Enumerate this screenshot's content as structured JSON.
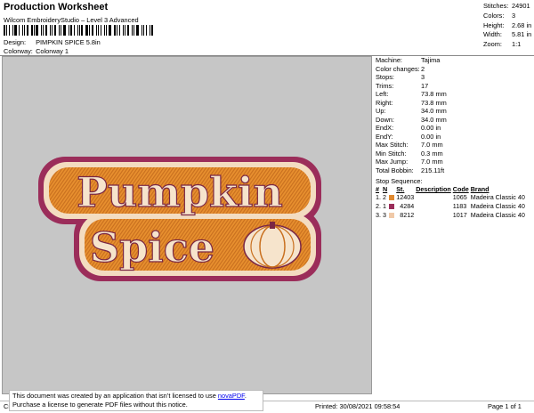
{
  "header": {
    "title": "Production Worksheet",
    "subtitle": "Wilcom EmbroideryStudio – Level 3 Advanced",
    "design_label": "Design:",
    "design_value": "PIMPKIN SPICE 5.8in",
    "colorway_label": "Colorway:",
    "colorway_value": "Colorway 1"
  },
  "stats": [
    {
      "label": "Stitches:",
      "value": "24901"
    },
    {
      "label": "Colors:",
      "value": "3"
    },
    {
      "label": "Height:",
      "value": "2.68 in"
    },
    {
      "label": "Width:",
      "value": "5.81 in"
    },
    {
      "label": "Zoom:",
      "value": "1:1"
    }
  ],
  "design_text": {
    "line1": "Pumpkin",
    "line2": "Spice"
  },
  "info": [
    {
      "label": "Machine:",
      "value": "Tajima"
    },
    {
      "label": "Color changes:",
      "value": "2"
    },
    {
      "label": "Stops:",
      "value": "3"
    },
    {
      "label": "Trims:",
      "value": "17"
    },
    {
      "label": "Left:",
      "value": "73.8 mm"
    },
    {
      "label": "Right:",
      "value": "73.8 mm"
    },
    {
      "label": "Up:",
      "value": "34.0 mm"
    },
    {
      "label": "Down:",
      "value": "34.0 mm"
    },
    {
      "label": "EndX:",
      "value": "0.00 in"
    },
    {
      "label": "EndY:",
      "value": "0.00 in"
    },
    {
      "label": "Max Stitch:",
      "value": "7.0 mm"
    },
    {
      "label": "Min Stitch:",
      "value": "0.3 mm"
    },
    {
      "label": "Max Jump:",
      "value": "7.0 mm"
    },
    {
      "label": "Total Bobbin:",
      "value": "215.11ft"
    }
  ],
  "stop_sequence": {
    "title": "Stop Sequence:",
    "headers": {
      "num": "#",
      "n": "N",
      "st": "St.",
      "description": "Description",
      "code": "Code",
      "brand": "Brand"
    },
    "rows": [
      {
        "num": "1.",
        "n": "2",
        "color": "#e0892f",
        "st": "12403",
        "description": "",
        "code": "1065",
        "brand": "Madeira Classic 40"
      },
      {
        "num": "2.",
        "n": "1",
        "color": "#9b2d5a",
        "st": "4284",
        "description": "",
        "code": "1183",
        "brand": "Madeira Classic 40"
      },
      {
        "num": "3.",
        "n": "3",
        "color": "#f0c9a8",
        "st": "8212",
        "description": "",
        "code": "1017",
        "brand": "Madeira Classic 40"
      }
    ]
  },
  "notice": {
    "line1_prefix": "This document was created by an application that isn’t licensed to use ",
    "link": "novaPDF",
    "line1_suffix": ".",
    "line2": "Purchase a license to generate PDF files without this notice."
  },
  "footer": {
    "left": "Cr",
    "printed": "Printed: 30/08/2021 09:58:54",
    "page": "Page 1 of 1"
  }
}
